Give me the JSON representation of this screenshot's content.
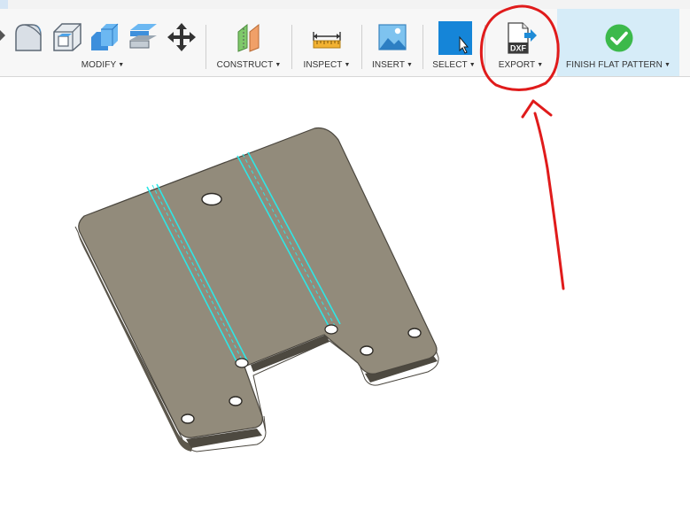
{
  "toolbar": {
    "modify_label": "MODIFY",
    "construct_label": "CONSTRUCT",
    "inspect_label": "INSPECT",
    "insert_label": "INSERT",
    "select_label": "SELECT",
    "export_label": "EXPORT",
    "export_icon_text": "DXF",
    "finish_label": "FINISH FLAT PATTERN",
    "caret": "▼"
  },
  "colors": {
    "toolbar_bg": "#f7f7f7",
    "finish_bg": "#d6ecf8",
    "part_face": "#928b7b",
    "bend_line": "#2ee6e6",
    "annotation_red": "#e01b1b",
    "check_green": "#3cb94b",
    "select_blue": "#1585d8"
  },
  "icons": {
    "modify": [
      "fillet-icon",
      "shell-icon",
      "combine-icon",
      "offset-face-icon",
      "move-icon"
    ],
    "construct": "offset-plane-icon",
    "inspect": "measure-icon",
    "insert": "insert-image-icon",
    "select": "select-icon",
    "export": "export-dxf-icon",
    "finish": "finish-check-icon"
  }
}
